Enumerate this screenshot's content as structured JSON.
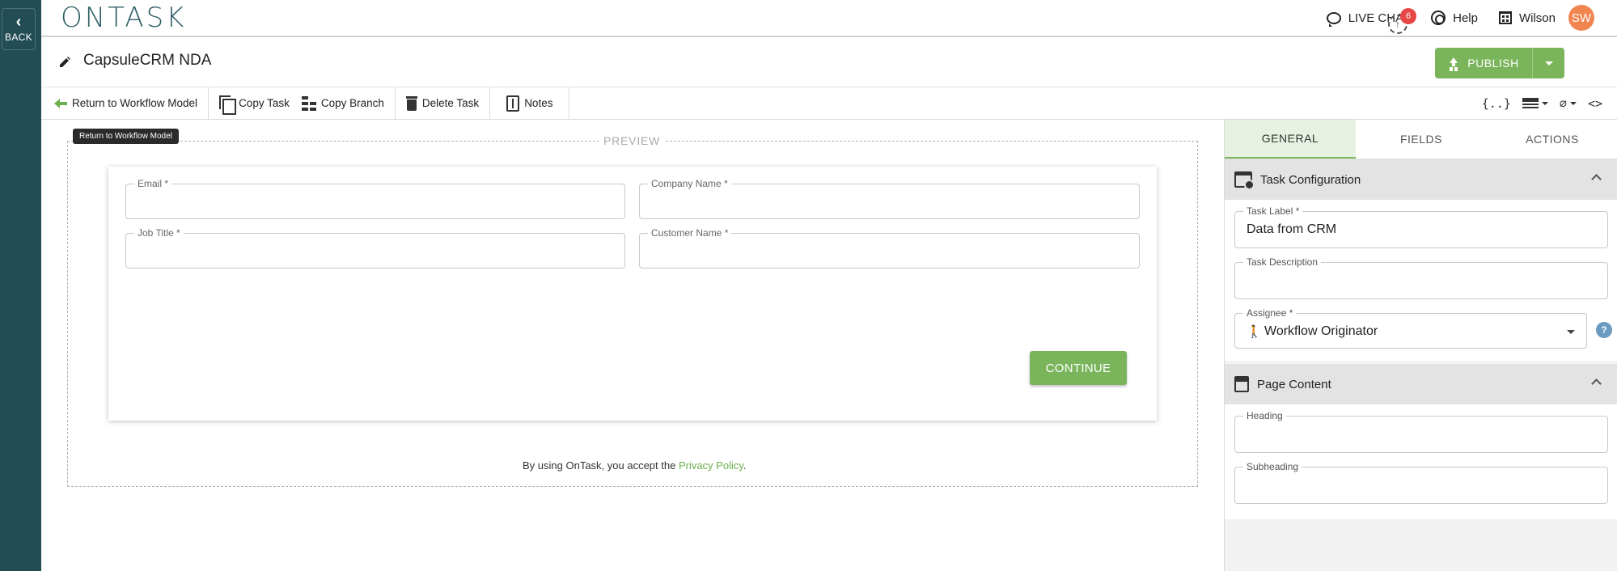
{
  "rail": {
    "back_label": "BACK"
  },
  "header": {
    "logo": "ONTASK",
    "live_chat": "LIVE CHAT",
    "help": "Help",
    "org": "Wilson",
    "avatar_initials": "SW",
    "avatar_color": "#f0854f"
  },
  "titlebar": {
    "title": "CapsuleCRM NDA",
    "notification_count": "6",
    "publish_label": "PUBLISH"
  },
  "toolbar": {
    "return_label": "Return to Workflow Model",
    "copy_task": "Copy Task",
    "copy_branch": "Copy Branch",
    "delete_task": "Delete Task",
    "notes": "Notes",
    "tooltip": "Return to Workflow Model",
    "right_icons": [
      "braces-icon",
      "table-icon",
      "attachment-icon",
      "code-icon"
    ]
  },
  "preview": {
    "label": "PREVIEW",
    "fields": [
      {
        "label": "Email *"
      },
      {
        "label": "Company Name *"
      },
      {
        "label": "Job Title *"
      },
      {
        "label": "Customer Name *"
      }
    ],
    "continue_label": "CONTINUE",
    "privacy_prefix": "By using OnTask, you accept the ",
    "privacy_link": "Privacy Policy",
    "privacy_suffix": "."
  },
  "panel": {
    "tabs": [
      "GENERAL",
      "FIELDS",
      "ACTIONS"
    ],
    "active_tab": "GENERAL",
    "task_config": {
      "title": "Task Configuration",
      "task_label_label": "Task Label *",
      "task_label_value": "Data from CRM",
      "task_description_label": "Task Description",
      "assignee_label": "Assignee *",
      "assignee_value": "Workflow Originator",
      "help": "?"
    },
    "page_content": {
      "title": "Page Content",
      "heading_label": "Heading",
      "subheading_label": "Subheading"
    }
  },
  "colors": {
    "rail": "#224d55",
    "accent_green": "#7ab55c",
    "badge_red": "#e84545",
    "link_green": "#6ab04c"
  }
}
